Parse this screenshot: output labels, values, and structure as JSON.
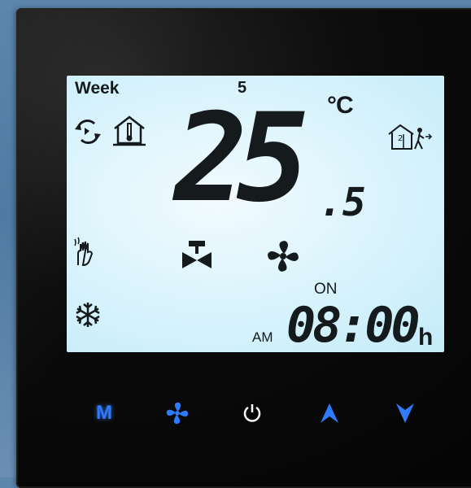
{
  "display": {
    "week_label": "Week",
    "day_number": "5",
    "temp_whole": "25",
    "temp_decimal": ".5",
    "temp_unit": "°C",
    "on_label": "ON",
    "am_label": "AM",
    "time": "08:00",
    "time_unit": "h"
  },
  "icons": {
    "auto_mode": "auto-cycle-icon",
    "room_temp": "house-thermometer-icon",
    "away": "house-person-exit-icon",
    "heating": "hand-heat-icon",
    "valve": "valve-icon",
    "fan": "fan-icon",
    "cooling": "snowflake-icon"
  },
  "buttons": {
    "mode_label": "M",
    "fan": "fan-button",
    "power": "power-button",
    "up": "up-arrow-button",
    "down": "down-arrow-button"
  },
  "colors": {
    "lcd_background": "#c9eefa",
    "lcd_segments": "#151a1c",
    "button_blue": "#2f7bff",
    "bezel": "#0c0c0c"
  }
}
